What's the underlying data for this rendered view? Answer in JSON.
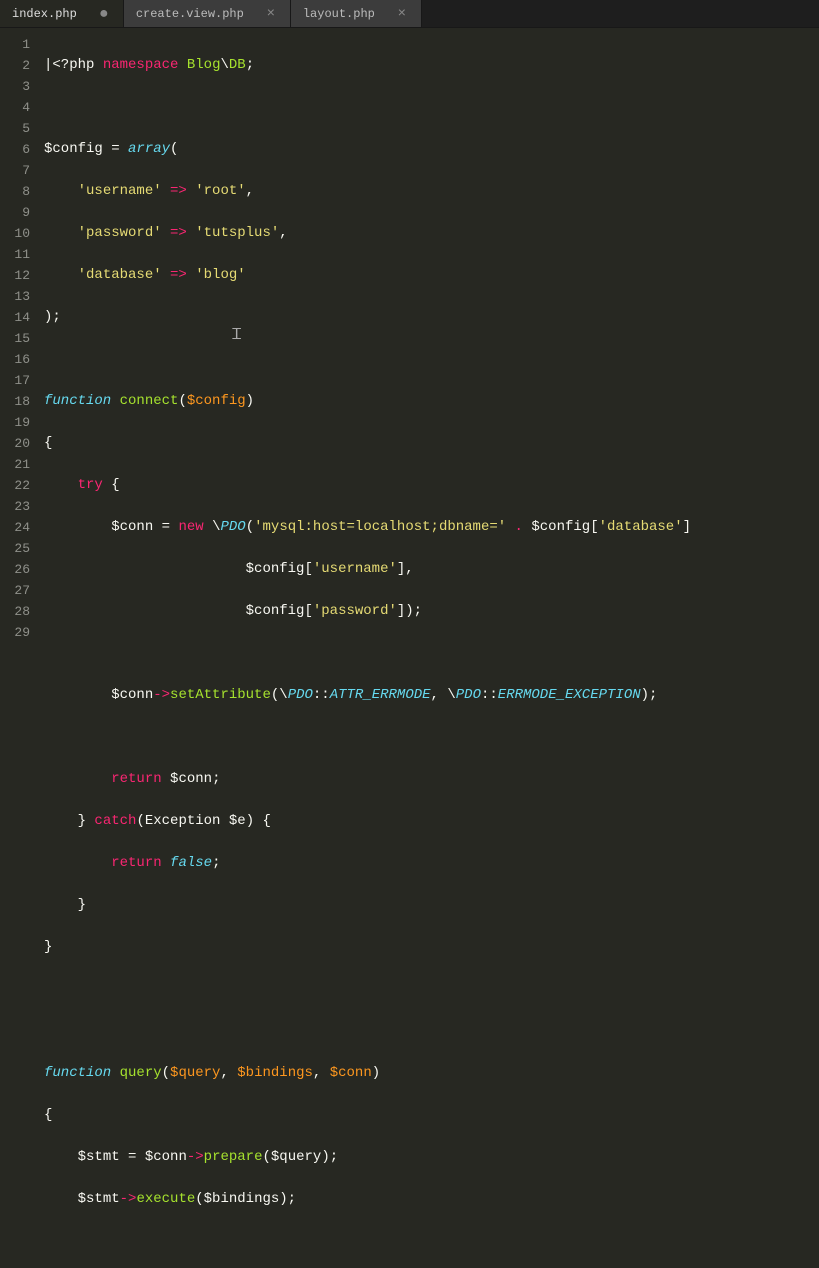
{
  "tabs": [
    {
      "label": "index.php",
      "active": true,
      "dirty": true
    },
    {
      "label": "create.view.php",
      "active": false,
      "dirty": false
    },
    {
      "label": "layout.php",
      "active": false,
      "dirty": false
    }
  ],
  "lineNumbers": [
    "1",
    "2",
    "3",
    "4",
    "5",
    "6",
    "7",
    "8",
    "9",
    "10",
    "11",
    "12",
    "13",
    "14",
    "15",
    "16",
    "17",
    "18",
    "19",
    "20",
    "21",
    "22",
    "23",
    "24",
    "25",
    "26",
    "27",
    "28",
    "29"
  ],
  "code": {
    "l1": {
      "php_open": "<?php",
      "namespace_kw": "namespace",
      "ns_blog": "Blog",
      "sep": "\\",
      "ns_db": "DB",
      "semi": ";"
    },
    "l3": {
      "var": "$config",
      "eq": " = ",
      "array_kw": "array",
      "paren": "("
    },
    "l4": {
      "indent": "    ",
      "key": "'username'",
      "arrow": " => ",
      "val": "'root'",
      "comma": ","
    },
    "l5": {
      "indent": "    ",
      "key": "'password'",
      "arrow": " => ",
      "val": "'tutsplus'",
      "comma": ","
    },
    "l6": {
      "indent": "    ",
      "key": "'database'",
      "arrow": " => ",
      "val": "'blog'"
    },
    "l7": {
      "close": ");"
    },
    "l9": {
      "function_kw": "function",
      "sp": " ",
      "name": "connect",
      "open": "(",
      "param": "$config",
      "close": ")"
    },
    "l10": {
      "brace": "{"
    },
    "l11": {
      "indent": "    ",
      "try_kw": "try",
      "brace": " {"
    },
    "l12": {
      "indent": "        ",
      "var": "$conn",
      "eq": " = ",
      "new_kw": "new",
      "sp": " ",
      "slash": "\\",
      "cls": "PDO",
      "open": "(",
      "dsn": "'mysql:host=localhost;dbname='",
      "concat": " . ",
      "cfg": "$config",
      "bracket_open": "[",
      "key": "'database'",
      "bracket_close": "]"
    },
    "l13": {
      "indent": "                        ",
      "cfg": "$config",
      "bracket_open": "[",
      "key": "'username'",
      "bracket_close": "],"
    },
    "l14": {
      "indent": "                        ",
      "cfg": "$config",
      "bracket_open": "[",
      "key": "'password'",
      "bracket_close": "]);"
    },
    "l16": {
      "indent": "        ",
      "var": "$conn",
      "arrow": "->",
      "method": "setAttribute",
      "open": "(\\",
      "cls1": "PDO",
      "scope1": "::",
      "const1": "ATTR_ERRMODE",
      "comma": ", \\",
      "cls2": "PDO",
      "scope2": "::",
      "const2": "ERRMODE_EXCEPTION",
      "close": ");"
    },
    "l18": {
      "indent": "        ",
      "return_kw": "return",
      "sp": " ",
      "var": "$conn",
      "semi": ";"
    },
    "l19": {
      "indent": "    ",
      "close_brace": "}",
      "sp": " ",
      "catch_kw": "catch",
      "open": "(",
      "exc": "Exception",
      "sp2": " ",
      "var": "$e",
      "close": ") {"
    },
    "l20": {
      "indent": "        ",
      "return_kw": "return",
      "sp": " ",
      "false_kw": "false",
      "semi": ";"
    },
    "l21": {
      "indent": "    ",
      "brace": "}"
    },
    "l22": {
      "brace": "}"
    },
    "l25": {
      "function_kw": "function",
      "sp": " ",
      "name": "query",
      "open": "(",
      "p1": "$query",
      "c1": ", ",
      "p2": "$bindings",
      "c2": ", ",
      "p3": "$conn",
      "close": ")"
    },
    "l26": {
      "brace": "{"
    },
    "l27": {
      "indent": "    ",
      "var": "$stmt",
      "eq": " = ",
      "conn": "$conn",
      "arrow": "->",
      "method": "prepare",
      "open": "(",
      "arg": "$query",
      "close": ");"
    },
    "l28": {
      "indent": "    ",
      "var": "$stmt",
      "arrow": "->",
      "method": "execute",
      "open": "(",
      "arg": "$bindings",
      "close": ");"
    }
  }
}
